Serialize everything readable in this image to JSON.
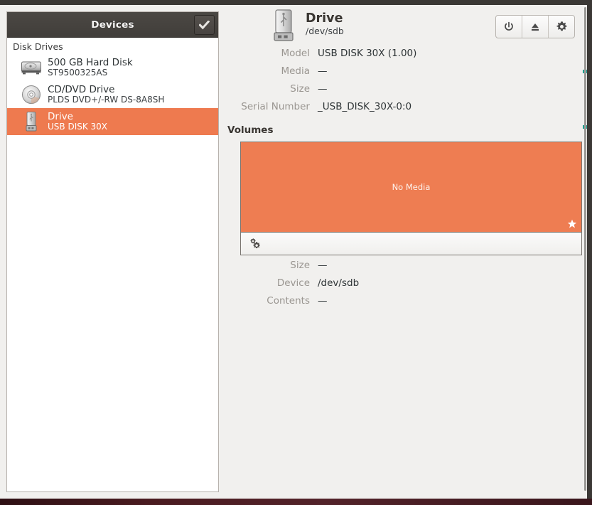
{
  "window": {
    "accent_orange": "#ee7d52",
    "header_dark": "#464340",
    "bg": "#f1f0ee"
  },
  "sidebar": {
    "title": "Devices",
    "confirm_icon": "check-icon",
    "group_label": "Disk Drives",
    "items": [
      {
        "name": "500 GB Hard Disk",
        "sub": "ST9500325AS",
        "icon": "hard-disk-icon",
        "selected": false
      },
      {
        "name": "CD/DVD Drive",
        "sub": "PLDS DVD+/-RW DS-8A8SH",
        "icon": "optical-disc-icon",
        "selected": false
      },
      {
        "name": "Drive",
        "sub": "USB DISK 30X",
        "icon": "usb-drive-icon",
        "selected": true
      }
    ]
  },
  "drive": {
    "icon": "usb-drive-icon",
    "title": "Drive",
    "path": "/dev/sdb",
    "toolbar": [
      {
        "name": "power-off-button",
        "icon": "power-icon"
      },
      {
        "name": "eject-button",
        "icon": "eject-icon"
      },
      {
        "name": "drive-options-button",
        "icon": "gear-icon"
      }
    ],
    "details": [
      {
        "label": "Model",
        "value": "USB DISK 30X (1.00)"
      },
      {
        "label": "Media",
        "value": "—"
      },
      {
        "label": "Size",
        "value": "—"
      },
      {
        "label": "Serial Number",
        "value": "_USB_DISK_30X-0:0"
      }
    ]
  },
  "volumes": {
    "heading": "Volumes",
    "block_label": "No Media",
    "block_badge_icon": "star-icon",
    "toolbar_icon": "gears-icon",
    "details": [
      {
        "label": "Size",
        "value": "—"
      },
      {
        "label": "Device",
        "value": "/dev/sdb"
      },
      {
        "label": "Contents",
        "value": "—"
      }
    ]
  }
}
